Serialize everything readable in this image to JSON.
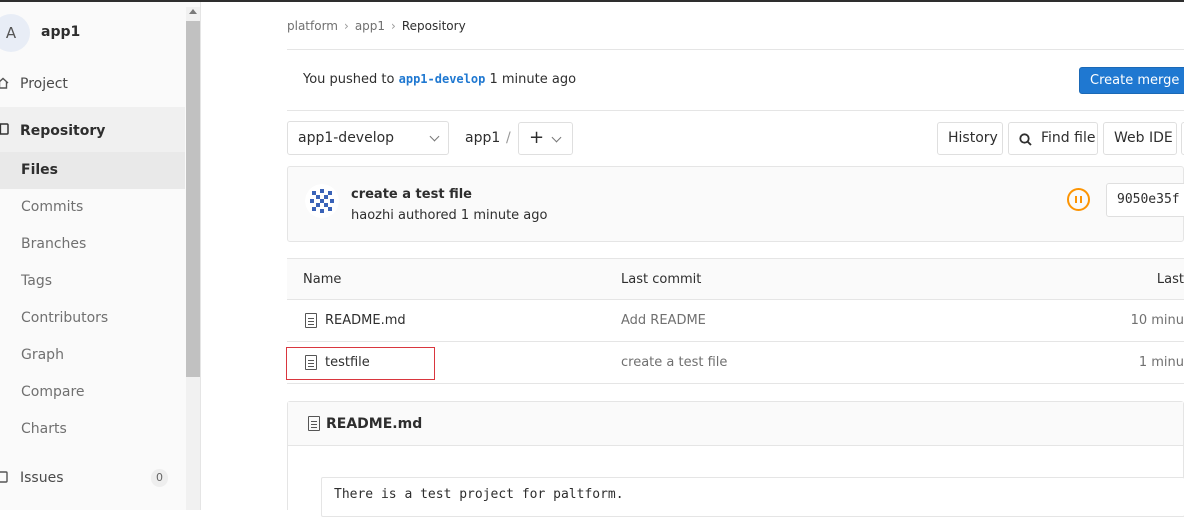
{
  "sidebar": {
    "project_avatar_letter": "A",
    "project_name": "app1",
    "items": [
      {
        "label": "Project"
      },
      {
        "label": "Repository"
      }
    ],
    "repository_subitems": [
      {
        "label": "Files"
      },
      {
        "label": "Commits"
      },
      {
        "label": "Branches"
      },
      {
        "label": "Tags"
      },
      {
        "label": "Contributors"
      },
      {
        "label": "Graph"
      },
      {
        "label": "Compare"
      },
      {
        "label": "Charts"
      }
    ],
    "issues": {
      "label": "Issues",
      "count": "0"
    }
  },
  "breadcrumb": {
    "items": [
      "platform",
      "app1"
    ],
    "current": "Repository"
  },
  "alert": {
    "prefix": "You pushed to",
    "branch": "app1-develop",
    "suffix": "1 minute ago",
    "button_label": "Create merge re"
  },
  "toolbar": {
    "branch": "app1-develop",
    "path_root": "app1",
    "path_sep": "/",
    "add_label": "+",
    "history_label": "History",
    "find_file_label": "Find file",
    "web_ide_label": "Web IDE"
  },
  "last_commit": {
    "title": "create a test file",
    "author": "haozhi",
    "meta": "authored 1 minute ago",
    "sha": "9050e35f",
    "pipeline_status": "running",
    "pipeline_color": "#fc9403"
  },
  "files_table": {
    "headers": [
      "Name",
      "Last commit",
      "Last"
    ],
    "rows": [
      {
        "name": "README.md",
        "commit": "Add README",
        "updated": "10 minu"
      },
      {
        "name": "testfile",
        "commit": "create a test file",
        "updated": "1 minu"
      }
    ]
  },
  "readme": {
    "title": "README.md",
    "content": "There is a test project for paltform."
  },
  "colors": {
    "primary": "#1f78d1",
    "highlight_border": "#d9363e"
  }
}
